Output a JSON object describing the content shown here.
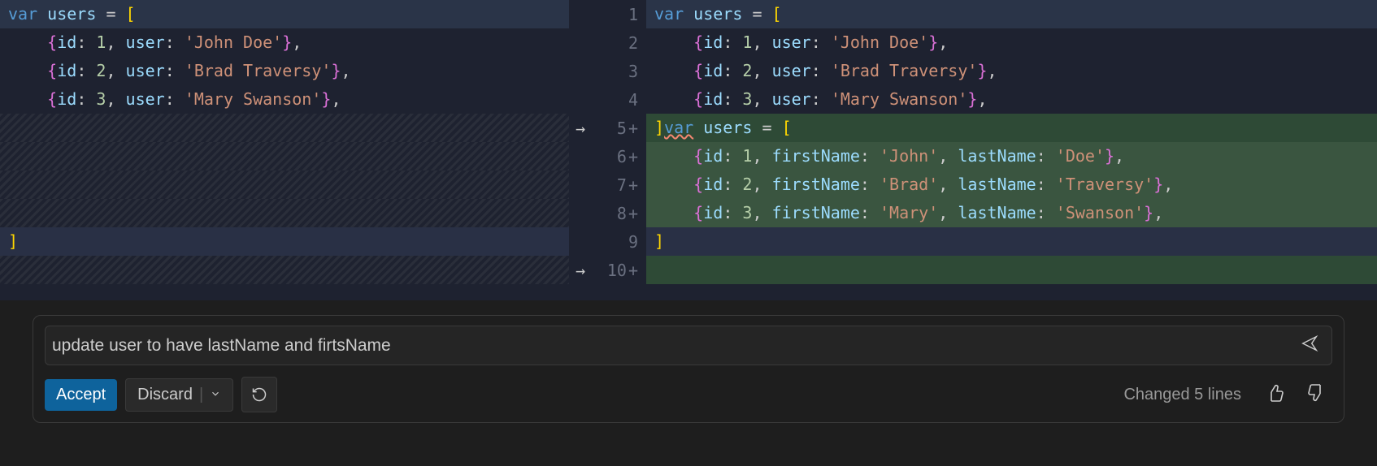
{
  "diff": {
    "left": {
      "lines": [
        {
          "tokens": [
            [
              "keyword",
              "var"
            ],
            [
              "text",
              " "
            ],
            [
              "var",
              "users"
            ],
            [
              "text",
              " "
            ],
            [
              "op",
              "="
            ],
            [
              "text",
              " "
            ],
            [
              "brace",
              "["
            ]
          ],
          "class": "line-highlight-dark"
        },
        {
          "tokens": [
            [
              "text",
              "    "
            ],
            [
              "brace2",
              "{"
            ],
            [
              "prop",
              "id"
            ],
            [
              "op",
              ":"
            ],
            [
              "text",
              " "
            ],
            [
              "num",
              "1"
            ],
            [
              "op",
              ","
            ],
            [
              "text",
              " "
            ],
            [
              "prop",
              "user"
            ],
            [
              "op",
              ":"
            ],
            [
              "text",
              " "
            ],
            [
              "str",
              "'John Doe'"
            ],
            [
              "brace2",
              "}"
            ],
            [
              "op",
              ","
            ]
          ],
          "class": ""
        },
        {
          "tokens": [
            [
              "text",
              "    "
            ],
            [
              "brace2",
              "{"
            ],
            [
              "prop",
              "id"
            ],
            [
              "op",
              ":"
            ],
            [
              "text",
              " "
            ],
            [
              "num",
              "2"
            ],
            [
              "op",
              ","
            ],
            [
              "text",
              " "
            ],
            [
              "prop",
              "user"
            ],
            [
              "op",
              ":"
            ],
            [
              "text",
              " "
            ],
            [
              "str",
              "'Brad Traversy'"
            ],
            [
              "brace2",
              "}"
            ],
            [
              "op",
              ","
            ]
          ],
          "class": ""
        },
        {
          "tokens": [
            [
              "text",
              "    "
            ],
            [
              "brace2",
              "{"
            ],
            [
              "prop",
              "id"
            ],
            [
              "op",
              ":"
            ],
            [
              "text",
              " "
            ],
            [
              "num",
              "3"
            ],
            [
              "op",
              ","
            ],
            [
              "text",
              " "
            ],
            [
              "prop",
              "user"
            ],
            [
              "op",
              ":"
            ],
            [
              "text",
              " "
            ],
            [
              "str",
              "'Mary Swanson'"
            ],
            [
              "brace2",
              "}"
            ],
            [
              "op",
              ","
            ]
          ],
          "class": ""
        },
        {
          "tokens": [],
          "class": "hatched"
        },
        {
          "tokens": [],
          "class": "hatched"
        },
        {
          "tokens": [],
          "class": "hatched"
        },
        {
          "tokens": [],
          "class": "hatched"
        },
        {
          "tokens": [
            [
              "brace",
              "]"
            ]
          ],
          "class": "line-bracket"
        },
        {
          "tokens": [],
          "class": "hatched"
        }
      ]
    },
    "gutter": [
      {
        "num": "1",
        "arrow": false,
        "plus": false
      },
      {
        "num": "2",
        "arrow": false,
        "plus": false
      },
      {
        "num": "3",
        "arrow": false,
        "plus": false
      },
      {
        "num": "4",
        "arrow": false,
        "plus": false
      },
      {
        "num": "5",
        "arrow": true,
        "plus": true
      },
      {
        "num": "6",
        "arrow": false,
        "plus": true
      },
      {
        "num": "7",
        "arrow": false,
        "plus": true
      },
      {
        "num": "8",
        "arrow": false,
        "plus": true
      },
      {
        "num": "9",
        "arrow": false,
        "plus": false
      },
      {
        "num": "10",
        "arrow": true,
        "plus": true
      }
    ],
    "right": {
      "lines": [
        {
          "tokens": [
            [
              "keyword",
              "var"
            ],
            [
              "text",
              " "
            ],
            [
              "var",
              "users"
            ],
            [
              "text",
              " "
            ],
            [
              "op",
              "="
            ],
            [
              "text",
              " "
            ],
            [
              "brace",
              "["
            ]
          ],
          "class": "line-highlight-dark"
        },
        {
          "tokens": [
            [
              "text",
              "    "
            ],
            [
              "brace2",
              "{"
            ],
            [
              "prop",
              "id"
            ],
            [
              "op",
              ":"
            ],
            [
              "text",
              " "
            ],
            [
              "num",
              "1"
            ],
            [
              "op",
              ","
            ],
            [
              "text",
              " "
            ],
            [
              "prop",
              "user"
            ],
            [
              "op",
              ":"
            ],
            [
              "text",
              " "
            ],
            [
              "str",
              "'John Doe'"
            ],
            [
              "brace2",
              "}"
            ],
            [
              "op",
              ","
            ]
          ],
          "class": ""
        },
        {
          "tokens": [
            [
              "text",
              "    "
            ],
            [
              "brace2",
              "{"
            ],
            [
              "prop",
              "id"
            ],
            [
              "op",
              ":"
            ],
            [
              "text",
              " "
            ],
            [
              "num",
              "2"
            ],
            [
              "op",
              ","
            ],
            [
              "text",
              " "
            ],
            [
              "prop",
              "user"
            ],
            [
              "op",
              ":"
            ],
            [
              "text",
              " "
            ],
            [
              "str",
              "'Brad Traversy'"
            ],
            [
              "brace2",
              "}"
            ],
            [
              "op",
              ","
            ]
          ],
          "class": ""
        },
        {
          "tokens": [
            [
              "text",
              "    "
            ],
            [
              "brace2",
              "{"
            ],
            [
              "prop",
              "id"
            ],
            [
              "op",
              ":"
            ],
            [
              "text",
              " "
            ],
            [
              "num",
              "3"
            ],
            [
              "op",
              ","
            ],
            [
              "text",
              " "
            ],
            [
              "prop",
              "user"
            ],
            [
              "op",
              ":"
            ],
            [
              "text",
              " "
            ],
            [
              "str",
              "'Mary Swanson'"
            ],
            [
              "brace2",
              "}"
            ],
            [
              "op",
              ","
            ]
          ],
          "class": ""
        },
        {
          "tokens": [
            [
              "brace",
              "]"
            ],
            [
              "squiggle-keyword",
              "var"
            ],
            [
              "text",
              " "
            ],
            [
              "var",
              "users"
            ],
            [
              "text",
              " "
            ],
            [
              "op",
              "="
            ],
            [
              "text",
              " "
            ],
            [
              "brace",
              "["
            ]
          ],
          "class": "line-added"
        },
        {
          "tokens": [
            [
              "text",
              "    "
            ],
            [
              "brace2",
              "{"
            ],
            [
              "prop",
              "id"
            ],
            [
              "op",
              ":"
            ],
            [
              "text",
              " "
            ],
            [
              "num",
              "1"
            ],
            [
              "op",
              ","
            ],
            [
              "text",
              " "
            ],
            [
              "prop",
              "firstName"
            ],
            [
              "op",
              ":"
            ],
            [
              "text",
              " "
            ],
            [
              "str",
              "'John'"
            ],
            [
              "op",
              ","
            ],
            [
              "text",
              " "
            ],
            [
              "prop",
              "lastName"
            ],
            [
              "op",
              ":"
            ],
            [
              "text",
              " "
            ],
            [
              "str",
              "'Doe'"
            ],
            [
              "brace2",
              "}"
            ],
            [
              "op",
              ","
            ]
          ],
          "class": "line-added-dark"
        },
        {
          "tokens": [
            [
              "text",
              "    "
            ],
            [
              "brace2",
              "{"
            ],
            [
              "prop",
              "id"
            ],
            [
              "op",
              ":"
            ],
            [
              "text",
              " "
            ],
            [
              "num",
              "2"
            ],
            [
              "op",
              ","
            ],
            [
              "text",
              " "
            ],
            [
              "prop",
              "firstName"
            ],
            [
              "op",
              ":"
            ],
            [
              "text",
              " "
            ],
            [
              "str",
              "'Brad'"
            ],
            [
              "op",
              ","
            ],
            [
              "text",
              " "
            ],
            [
              "prop",
              "lastName"
            ],
            [
              "op",
              ":"
            ],
            [
              "text",
              " "
            ],
            [
              "str",
              "'Traversy'"
            ],
            [
              "brace2",
              "}"
            ],
            [
              "op",
              ","
            ]
          ],
          "class": "line-added-dark"
        },
        {
          "tokens": [
            [
              "text",
              "    "
            ],
            [
              "brace2",
              "{"
            ],
            [
              "prop",
              "id"
            ],
            [
              "op",
              ":"
            ],
            [
              "text",
              " "
            ],
            [
              "num",
              "3"
            ],
            [
              "op",
              ","
            ],
            [
              "text",
              " "
            ],
            [
              "prop",
              "firstName"
            ],
            [
              "op",
              ":"
            ],
            [
              "text",
              " "
            ],
            [
              "str",
              "'Mary'"
            ],
            [
              "op",
              ","
            ],
            [
              "text",
              " "
            ],
            [
              "prop",
              "lastName"
            ],
            [
              "op",
              ":"
            ],
            [
              "text",
              " "
            ],
            [
              "str",
              "'Swanson'"
            ],
            [
              "brace2",
              "}"
            ],
            [
              "op",
              ","
            ]
          ],
          "class": "line-added-dark"
        },
        {
          "tokens": [
            [
              "brace",
              "]"
            ]
          ],
          "class": "line-bracket"
        },
        {
          "tokens": [],
          "class": "line-added"
        }
      ]
    }
  },
  "input": {
    "value": "update user to have lastName and firtsName"
  },
  "buttons": {
    "accept": "Accept",
    "discard": "Discard"
  },
  "status": {
    "changed": "Changed 5 lines"
  }
}
